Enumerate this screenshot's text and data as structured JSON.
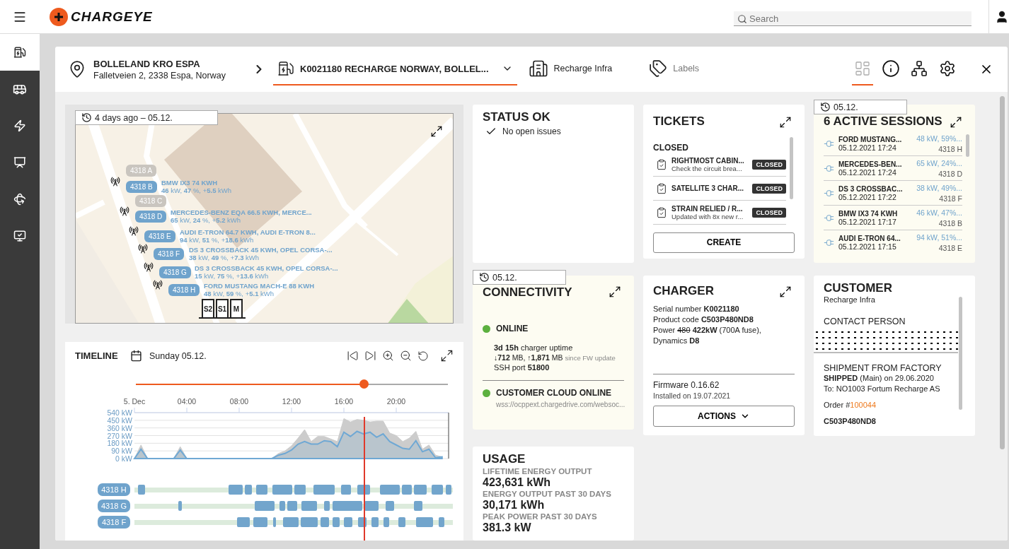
{
  "app": {
    "logo": "CHARGEYE",
    "search": {
      "placeholder": "Search"
    }
  },
  "sidebar": {
    "items": [
      {
        "kind": "charger",
        "selected": true
      },
      {
        "kind": "bus",
        "selected": false
      },
      {
        "kind": "power",
        "selected": false
      },
      {
        "kind": "screen",
        "selected": false
      },
      {
        "kind": "rotate",
        "selected": false
      },
      {
        "kind": "monitor",
        "selected": false
      }
    ]
  },
  "header": {
    "site": {
      "name": "BOLLELAND KRO ESPA",
      "address": "Falletveien 2, 2338 Espa, Norway"
    },
    "tabs": [
      {
        "kind": "charger",
        "label": "K0021180 RECHARGE NORWAY, BOLLEL...",
        "selected": true
      },
      {
        "kind": "customer",
        "label": "Recharge Infra",
        "selected": false
      },
      {
        "kind": "labels",
        "label": "Labels",
        "selected": false
      }
    ],
    "tools": [
      {
        "kind": "dashboard",
        "selected": true
      },
      {
        "kind": "info",
        "selected": false
      },
      {
        "kind": "network",
        "selected": false
      },
      {
        "kind": "settings",
        "selected": false
      }
    ]
  },
  "map": {
    "time": "4 days ago – 05.12.",
    "chargers": [
      {
        "id": "4318 A",
        "active": false
      },
      {
        "id": "4318 B",
        "active": true,
        "vehicle": "BMW IX3 74 KWH",
        "reading": "**46** kW, **47** %, +**5.5** kWh"
      },
      {
        "id": "4318 C",
        "active": false
      },
      {
        "id": "4318 D",
        "active": true,
        "vehicle": "MERCEDES-BENZ EQA 66.5 KWH, MERCE...",
        "reading": "**65** kW, **24** %, +**5.2** kWh"
      },
      {
        "id": "4318 E",
        "active": true,
        "vehicle": "AUDI E-TRON 64.7 KWH, AUDI E-TRON 8...",
        "reading": "**94** kW, **51** %, +**18.6** kWh"
      },
      {
        "id": "4318 F",
        "active": true,
        "vehicle": "DS 3 CROSSBACK 45 KWH, OPEL CORSA-...",
        "reading": "**38** kW, **49** %, +**7.3** kWh"
      },
      {
        "id": "4318 G",
        "active": true,
        "vehicle": "DS 3 CROSSBACK 45 KWH, OPEL CORSA-...",
        "reading": "**15** kW, **75** %, +**13.6** kWh"
      },
      {
        "id": "4318 H",
        "active": true,
        "vehicle": "FORD MUSTANG MACH-E 88 KWH",
        "reading": "**48** kW, **59** %, +**5.1** kWh"
      }
    ],
    "cabinets": [
      "S2",
      "S1",
      "M"
    ]
  },
  "timeline": {
    "title": "TIMELINE",
    "date": "Sunday 05.12.",
    "slider": {
      "level": 0.73
    },
    "chart_data": {
      "type": "area",
      "grid": true,
      "x": [
        0,
        0.5,
        1,
        1.5,
        2,
        2.5,
        3,
        3.5,
        4,
        4.5,
        5,
        5.5,
        6,
        6.5,
        7,
        7.5,
        8,
        8.5,
        9,
        9.5,
        10,
        10.5,
        11,
        11.5,
        12,
        12.5,
        13,
        13.5,
        14,
        14.5,
        15,
        15.5,
        16,
        16.5,
        17,
        17.5,
        18,
        18.5,
        19,
        19.5,
        20,
        20.5,
        21,
        21.5,
        22,
        22.5,
        23,
        23.5
      ],
      "series": [
        {
          "color": "#cccccc",
          "values": [
            0,
            160,
            0,
            0,
            0,
            0,
            0,
            140,
            0,
            0,
            0,
            0,
            0,
            0,
            0,
            0,
            0,
            0,
            0,
            0,
            0,
            0,
            60,
            90,
            150,
            240,
            340,
            200,
            260,
            260,
            230,
            200,
            470,
            430,
            460,
            450,
            430,
            440,
            440,
            300,
            270,
            200,
            240,
            320,
            110,
            160,
            40,
            20
          ]
        },
        {
          "color": "#6fa8d4",
          "values": [
            0,
            110,
            0,
            0,
            0,
            0,
            0,
            100,
            0,
            0,
            0,
            0,
            0,
            0,
            0,
            0,
            0,
            0,
            0,
            0,
            0,
            0,
            40,
            60,
            100,
            170,
            200,
            170,
            170,
            210,
            200,
            140,
            310,
            260,
            320,
            290,
            310,
            250,
            290,
            200,
            160,
            120,
            110,
            210,
            80,
            110,
            10,
            20
          ]
        }
      ],
      "xlim": [
        0,
        24
      ],
      "ylim": [
        0,
        540
      ],
      "xticks": [
        {
          "value": 0,
          "label": "5. Dec"
        },
        {
          "value": 4,
          "label": "04:00"
        },
        {
          "value": 8,
          "label": "08:00"
        },
        {
          "value": 12,
          "label": "12:00"
        },
        {
          "value": 16,
          "label": "16:00"
        },
        {
          "value": 20,
          "label": "20:00"
        }
      ],
      "yticks": [
        {
          "value": 0,
          "label": "0 kW"
        },
        {
          "value": 90,
          "label": "90 kW"
        },
        {
          "value": 180,
          "label": "180 kW"
        },
        {
          "value": 270,
          "label": "270 kW"
        },
        {
          "value": 360,
          "label": "360 kW"
        },
        {
          "value": 450,
          "label": "450 kW"
        },
        {
          "value": 540,
          "label": "540 kW"
        }
      ]
    },
    "lanes": [
      "4318 H",
      "4318 G",
      "4318 F"
    ]
  },
  "status": {
    "title": "STATUS OK",
    "message": "No open issues"
  },
  "connectivity": {
    "time": "05.12.",
    "title": "CONNECTIVITY",
    "online": {
      "label": "ONLINE",
      "on": true
    },
    "uptime": "**3d 15h** charger uptime",
    "traffic": "↓**712** MB, ↑**1,871** MB",
    "traffic_note": "since FW update",
    "ssh": "SSH port **51800**",
    "cloud": {
      "label": "CUSTOMER CLOUD ONLINE",
      "on": true,
      "url": "wss://ocppext.chargedrive.com/websoc..."
    }
  },
  "usage": {
    "title": "USAGE",
    "metrics": [
      {
        "label": "LIFETIME ENERGY OUTPUT",
        "value": "423,631 kWh"
      },
      {
        "label": "ENERGY OUTPUT PAST 30 DAYS",
        "value": "30,171 kWh"
      },
      {
        "label": "PEAK POWER PAST 30 DAYS",
        "value": "381.3 kW"
      }
    ]
  },
  "tickets": {
    "title": "TICKETS",
    "section": "CLOSED",
    "items": [
      {
        "title": "RIGHTMOST CABIN...",
        "subtitle": "Check the circuit brea...",
        "status": "CLOSED"
      },
      {
        "title": "SATELLITE 3 CHAR...",
        "status": "CLOSED"
      },
      {
        "title": "STRAIN RELIED / R...",
        "subtitle": "Updated with 8x new r...",
        "status": "CLOSED"
      }
    ],
    "create": "CREATE"
  },
  "charger": {
    "title": "CHARGER",
    "serial": "Serial number **K0021180**",
    "product": "Product code **C503P480ND8**",
    "power": {
      "label": "Power",
      "old": "480",
      "value": "**422kW** (700A fuse), Dynamics **D8**"
    },
    "firmware": "Firmware 0.16.62",
    "installed": "Installed on 19.07.2021",
    "actions": "ACTIONS"
  },
  "sessions": {
    "time": "05.12.",
    "title": "6 ACTIVE SESSIONS",
    "items": [
      {
        "vehicle": "FORD MUSTANG...",
        "time": "05.12.2021 17:24",
        "reading": "48 kW, 59%...",
        "charger": "4318 H"
      },
      {
        "vehicle": "MERCEDES-BEN...",
        "time": "05.12.2021 17:24",
        "reading": "65 kW, 24%...",
        "charger": "4318 D"
      },
      {
        "vehicle": "DS 3 CROSSBAC...",
        "time": "05.12.2021 17:22",
        "reading": "38 kW, 49%...",
        "charger": "4318 F"
      },
      {
        "vehicle": "BMW IX3 74 KWH",
        "time": "05.12.2021 17:17",
        "reading": "46 kW, 47%...",
        "charger": "4318 B"
      },
      {
        "vehicle": "AUDI E-TRON 64...",
        "time": "05.12.2021 17:15",
        "reading": "94 kW, 51%...",
        "charger": "4318 E"
      }
    ]
  },
  "customer": {
    "title": "CUSTOMER",
    "name": "Recharge Infra",
    "contact_title": "CONTACT PERSON",
    "shipment_title": "SHIPMENT FROM FACTORY",
    "shipped": "**SHIPPED** (Main) on 29.06.2020",
    "to": "To: NO1003 Fortum Recharge AS",
    "order_label": "Order #",
    "order_number": "100044",
    "product": "C503P480ND8"
  }
}
